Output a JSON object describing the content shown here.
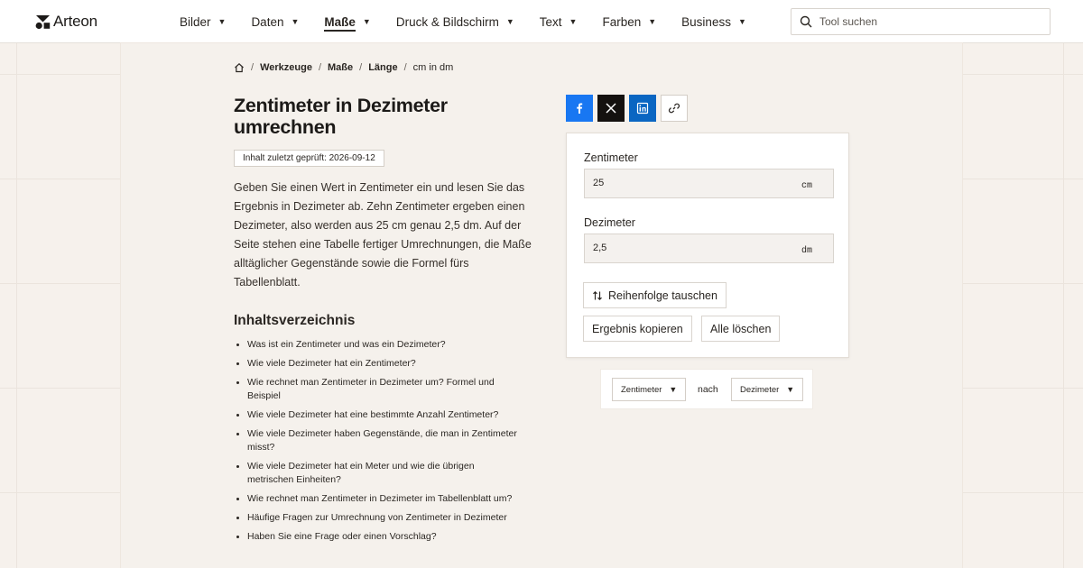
{
  "header": {
    "brand": "Arteon",
    "nav": [
      {
        "label": "Bilder",
        "active": false
      },
      {
        "label": "Daten",
        "active": false
      },
      {
        "label": "Maße",
        "active": true
      },
      {
        "label": "Druck & Bildschirm",
        "active": false
      },
      {
        "label": "Text",
        "active": false
      },
      {
        "label": "Farben",
        "active": false
      },
      {
        "label": "Business",
        "active": false
      }
    ],
    "caret": "▼",
    "search_placeholder": "Tool suchen"
  },
  "breadcrumb": {
    "items": [
      "Werkzeuge",
      "Maße",
      "Länge",
      "cm in dm"
    ],
    "separator": "/"
  },
  "page": {
    "title": "Zentimeter in Dezimeter umrechnen",
    "checked_badge": "Inhalt zuletzt geprüft: 2026-09-12",
    "intro": "Geben Sie einen Wert in Zentimeter ein und lesen Sie das Ergebnis in Dezimeter ab. Zehn Zentimeter ergeben einen Dezimeter, also werden aus 25 cm genau 2,5 dm. Auf der Seite stehen eine Tabelle fertiger Umrechnungen, die Maße alltäglicher Gegenstände sowie die Formel fürs Tabellenblatt.",
    "toc_heading": "Inhaltsverzeichnis",
    "toc": [
      "Was ist ein Zentimeter und was ein Dezimeter?",
      "Wie viele Dezimeter hat ein Zentimeter?",
      "Wie rechnet man Zentimeter in Dezimeter um? Formel und Beispiel",
      "Wie viele Dezimeter hat eine bestimmte Anzahl Zentimeter?",
      "Wie viele Dezimeter haben Gegenstände, die man in Zentimeter misst?",
      "Wie viele Dezimeter hat ein Meter und wie die übrigen metrischen Einheiten?",
      "Wie rechnet man Zentimeter in Dezimeter im Tabellenblatt um?",
      "Häufige Fragen zur Umrechnung von Zentimeter in Dezimeter",
      "Haben Sie eine Frage oder einen Vorschlag?"
    ]
  },
  "share": {
    "icons": [
      "facebook-icon",
      "x-icon",
      "linkedin-icon",
      "link-icon"
    ],
    "colors": {
      "facebook": "#1877f2",
      "x": "#14110f",
      "linkedin": "#0a66c2"
    }
  },
  "converter": {
    "input_label": "Zentimeter",
    "input_value": "25",
    "input_unit": "cm",
    "output_label": "Dezimeter",
    "output_value": "2,5",
    "output_unit": "dm",
    "swap_label": "Reihenfolge tauschen",
    "copy_label": "Ergebnis kopieren",
    "clear_label": "Alle löschen"
  },
  "unit_select": {
    "from": "Zentimeter",
    "connector": "nach",
    "to": "Dezimeter"
  }
}
